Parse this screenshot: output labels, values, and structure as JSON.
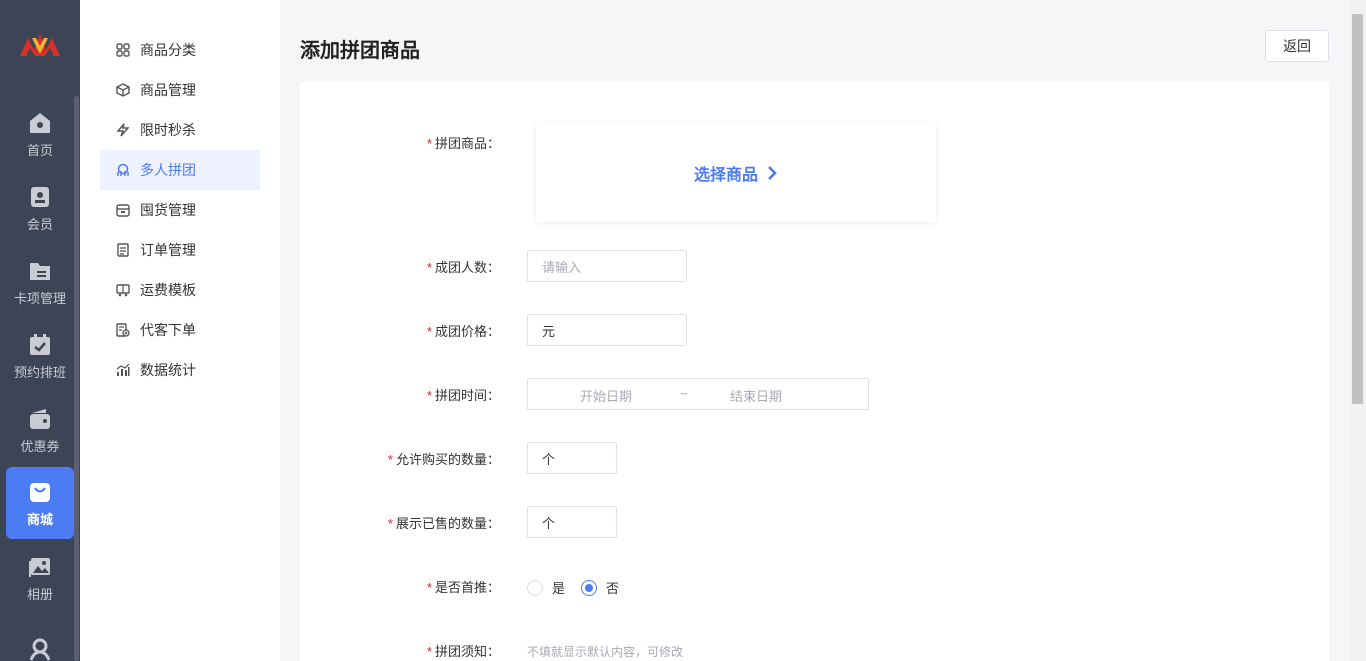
{
  "rail": {
    "items": [
      {
        "label": "首页",
        "icon": "home-icon"
      },
      {
        "label": "会员",
        "icon": "member-card-icon"
      },
      {
        "label": "卡项管理",
        "icon": "folder-icon"
      },
      {
        "label": "预约排班",
        "icon": "calendar-check-icon"
      },
      {
        "label": "优惠券",
        "icon": "wallet-icon"
      },
      {
        "label": "商城",
        "icon": "shopping-bag-icon"
      },
      {
        "label": "相册",
        "icon": "album-icon"
      },
      {
        "label": "",
        "icon": "group-people-icon"
      }
    ],
    "active_index": 5
  },
  "submenu": {
    "items": [
      {
        "label": "商品分类",
        "icon": "grid-icon"
      },
      {
        "label": "商品管理",
        "icon": "box-icon"
      },
      {
        "label": "限时秒杀",
        "icon": "lightning-icon"
      },
      {
        "label": "多人拼团",
        "icon": "group-icon"
      },
      {
        "label": "囤货管理",
        "icon": "storage-icon"
      },
      {
        "label": "订单管理",
        "icon": "document-icon"
      },
      {
        "label": "运费模板",
        "icon": "delivery-truck-icon"
      },
      {
        "label": "代客下单",
        "icon": "order-add-icon"
      },
      {
        "label": "数据统计",
        "icon": "bar-chart-icon"
      }
    ],
    "active_index": 3
  },
  "page": {
    "title": "添加拼团商品",
    "back_label": "返回"
  },
  "form": {
    "product": {
      "label": "拼团商品：",
      "action": "选择商品"
    },
    "group_size": {
      "label": "成团人数：",
      "placeholder": "请输入"
    },
    "group_price": {
      "label": "成团价格：",
      "suffix": "元"
    },
    "group_time": {
      "label": "拼团时间：",
      "start_placeholder": "开始日期",
      "separator": "~",
      "end_placeholder": "结束日期"
    },
    "buy_limit": {
      "label": "允许购买的数量：",
      "suffix": "个"
    },
    "sold_display": {
      "label": "展示已售的数量：",
      "suffix": "个"
    },
    "homepage_recommend": {
      "label": "是否首推：",
      "options": [
        "是",
        "否"
      ],
      "selected": "否"
    },
    "notice": {
      "label": "拼团须知：",
      "hint": "不填就显示默认内容，可修改"
    }
  },
  "colors": {
    "accent": "#4c7cf3",
    "rail_bg": "#3d4455",
    "required": "#e02020"
  }
}
